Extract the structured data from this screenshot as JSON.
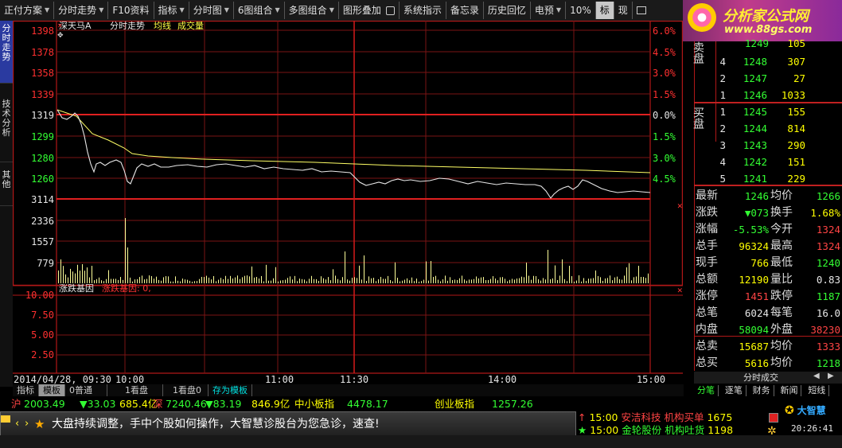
{
  "toolbar": {
    "items": [
      "正付方案",
      "分时走势",
      "F10资料",
      "指标",
      "分时图",
      "6图组合",
      "多图组合",
      "图形叠加",
      "系统指示",
      "备忘录",
      "历史回忆",
      "电预",
      "10%",
      "标",
      "现"
    ]
  },
  "left_tabs": [
    "分时走势",
    "技术分析",
    "其他"
  ],
  "chart_header": {
    "stock": "深天马A",
    "mode": "分时走势",
    "avg": "均线",
    "vol": "成交量"
  },
  "price_axis": [
    "1398",
    "1378",
    "1358",
    "1339",
    "1319",
    "1299",
    "1280",
    "1260"
  ],
  "pct_axis": [
    "6.0%",
    "4.5%",
    "3.0%",
    "1.5%",
    "0.0%",
    "1.5%",
    "3.0%",
    "4.5%"
  ],
  "vol_axis": [
    "3114",
    "2336",
    "1557",
    "779"
  ],
  "lower_header": {
    "name": "涨跌基因",
    "value": "涨跌基因: 0,"
  },
  "lower_axis": [
    "10.00",
    "7.50",
    "5.00",
    "2.50"
  ],
  "time_axis": {
    "start": "2014/04/28, 09:30",
    "t1": "10:00",
    "t2": "11:00",
    "t3": "11:30",
    "t4": "14:00",
    "t5": "15:00"
  },
  "logo": {
    "name": "分析家公式网",
    "url": "www.88gs.com"
  },
  "orderbook": {
    "sell_label": "卖盘",
    "buy_label": "买盘",
    "sell": [
      {
        "lv": "4",
        "price": "1248",
        "vol": "307"
      },
      {
        "lv": "2",
        "price": "1247",
        "vol": "27"
      },
      {
        "lv": "1",
        "price": "1246",
        "vol": "1033"
      }
    ],
    "sell_partial": {
      "price": "1249",
      "vol": "105"
    },
    "buy": [
      {
        "lv": "1",
        "price": "1245",
        "vol": "155"
      },
      {
        "lv": "2",
        "price": "1244",
        "vol": "814"
      },
      {
        "lv": "3",
        "price": "1243",
        "vol": "290"
      },
      {
        "lv": "4",
        "price": "1242",
        "vol": "151"
      },
      {
        "lv": "5",
        "price": "1241",
        "vol": "229"
      }
    ]
  },
  "quote": [
    {
      "l1": "最新",
      "v1": "1246",
      "c1": "green",
      "l2": "均价",
      "v2": "1266",
      "c2": "green"
    },
    {
      "l1": "涨跌",
      "v1": "▼073",
      "c1": "green",
      "l2": "换手",
      "v2": "1.68%",
      "c2": "yellow"
    },
    {
      "l1": "涨幅",
      "v1": "-5.53%",
      "c1": "green",
      "l2": "今开",
      "v2": "1324",
      "c2": "red"
    },
    {
      "l1": "总手",
      "v1": "96324",
      "c1": "yellow",
      "l2": "最高",
      "v2": "1324",
      "c2": "red"
    },
    {
      "l1": "现手",
      "v1": "766",
      "c1": "yellow",
      "l2": "最低",
      "v2": "1240",
      "c2": "green"
    },
    {
      "l1": "总额",
      "v1": "12190",
      "c1": "yellow",
      "l2": "量比",
      "v2": "0.83",
      "c2": "white"
    },
    {
      "l1": "涨停",
      "v1": "1451",
      "c1": "red",
      "l2": "跌停",
      "v2": "1187",
      "c2": "green"
    },
    {
      "l1": "总笔",
      "v1": "6024",
      "c1": "white",
      "l2": "每笔",
      "v2": "16.0",
      "c2": "white"
    },
    {
      "l1": "内盘",
      "v1": "58094",
      "c1": "green",
      "l2": "外盘",
      "v2": "38230",
      "c2": "red"
    },
    {
      "l1": "总卖",
      "v1": "15687",
      "c1": "yellow",
      "l2": "均价",
      "v2": "1333",
      "c2": "red"
    },
    {
      "l1": "总买",
      "v1": "5616",
      "c1": "yellow",
      "l2": "均价",
      "v2": "1218",
      "c2": "green"
    }
  ],
  "right_bottom": {
    "title": "分时成交",
    "tabs": [
      "分笔",
      "逐笔",
      "财务",
      "新闻",
      "短线"
    ]
  },
  "bottom_tabs": [
    "指标",
    "模板",
    "0普通",
    "1看盘",
    "1看盘0",
    "存为模板"
  ],
  "ticker": {
    "sh_label": "沪",
    "sh_index": "2003.49",
    "sh_chg": "▼33.03",
    "sh_amt": "685.4亿",
    "sz_label": "深",
    "sz_index": "7240.46",
    "sz_chg": "▼83.19",
    "sz_amt": "846.9亿",
    "sme_label": "中小板指",
    "sme_val": "4478.17",
    "gem_label": "创业板指",
    "gem_val": "1257.26"
  },
  "news": {
    "text": "大盘持续调整，手中个股如何操作，大智慧诊股台为您急诊，速查!"
  },
  "alerts": [
    {
      "time": "15:00",
      "name": "安洁科技",
      "act": "机构买单",
      "val": "1675"
    },
    {
      "time": "15:00",
      "name": "金轮股份",
      "act": "机构吐货",
      "val": "1198"
    }
  ],
  "status": {
    "brand": "大智慧",
    "clock": "20:26:41"
  }
}
